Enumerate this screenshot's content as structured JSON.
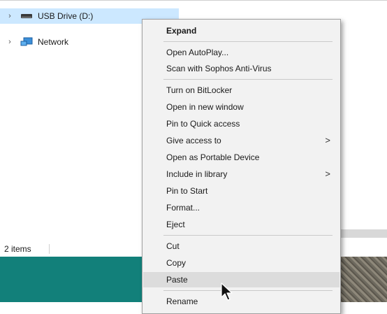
{
  "navigation": {
    "items": [
      {
        "label": "USB Drive (D:)",
        "icon": "usb-drive-icon",
        "expand_glyph": "›",
        "selected": true
      },
      {
        "label": "Network",
        "icon": "network-icon",
        "expand_glyph": "›",
        "selected": false
      }
    ]
  },
  "status_bar": {
    "item_count": "2 items"
  },
  "context_menu": {
    "items": {
      "expand": "Expand",
      "open_autoplay": "Open AutoPlay...",
      "scan_sophos": "Scan with Sophos Anti-Virus",
      "turn_on_bitlocker": "Turn on BitLocker",
      "open_new_window": "Open in new window",
      "pin_quick_access": "Pin to Quick access",
      "give_access_to": "Give access to",
      "open_portable_device": "Open as Portable Device",
      "include_in_library": "Include in library",
      "pin_to_start": "Pin to Start",
      "format": "Format...",
      "eject": "Eject",
      "cut": "Cut",
      "copy": "Copy",
      "paste": "Paste",
      "rename": "Rename"
    },
    "submenu_glyph": ">",
    "hovered_item": "Paste"
  },
  "colors": {
    "selection": "#cce8ff",
    "menu_background": "#f2f2f2",
    "menu_hover": "#dcdcdc",
    "desktop": "#12807a"
  }
}
